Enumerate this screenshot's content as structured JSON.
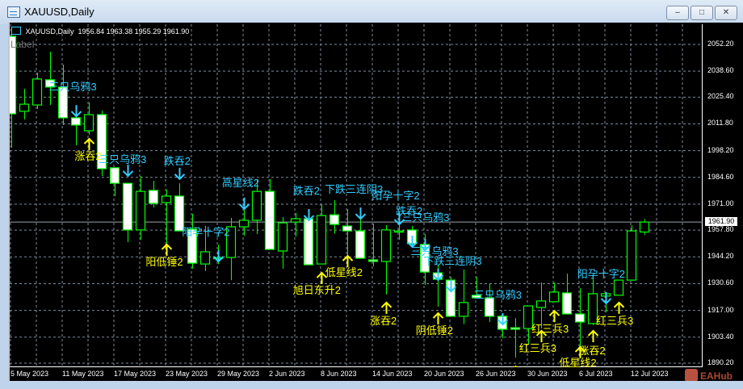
{
  "window": {
    "title": "XAUUSD,Daily",
    "buttons": [
      "minimize",
      "maximize",
      "close"
    ]
  },
  "chart_header": {
    "symbol": "XAUUSD,Daily",
    "open": "1956.84",
    "high": "1963.38",
    "low": "1955.29",
    "close": "1961.90",
    "label_object": "Label"
  },
  "colors": {
    "background": "#000000",
    "bull_outline": "#00ff00",
    "bear_fill": "#ffffff",
    "grid": "#7f8c9a",
    "bearish_signal": "#33ccff",
    "bullish_signal": "#ffff00"
  },
  "watermark": "EAHub",
  "chart_data": {
    "type": "candlestick",
    "title": "XAUUSD,Daily",
    "ylim": [
      1890.2,
      2052.2
    ],
    "price_ticks": [
      "2052.20",
      "2038.60",
      "2025.40",
      "2011.80",
      "1998.20",
      "1984.60",
      "1971.00",
      "1957.80",
      "1944.20",
      "1930.60",
      "1917.00",
      "1903.40",
      "1890.20"
    ],
    "current_price": "1961.90",
    "date_labels": [
      "5 May 2023",
      "11 May 2023",
      "17 May 2023",
      "23 May 2023",
      "29 May 2023",
      "2 Jun 2023",
      "8 Jun 2023",
      "14 Jun 2023",
      "20 Jun 2023",
      "26 Jun 2023",
      "30 Jun 2023",
      "6 Jul 2023",
      "12 Jul 2023"
    ],
    "grid": true,
    "ohlc": [
      [
        2056.3,
        2058.4,
        1999.7,
        2016.9
      ],
      [
        2018.2,
        2029.6,
        2014.1,
        2021.8
      ],
      [
        2021.4,
        2037.8,
        2019.4,
        2034.6
      ],
      [
        2034.2,
        2048.5,
        2021.4,
        2030.5
      ],
      [
        2030.5,
        2041.9,
        2011.2,
        2014.9
      ],
      [
        2014.9,
        2018.2,
        2000.9,
        2011.2
      ],
      [
        2008.3,
        2022.7,
        2006.3,
        2016.5
      ],
      [
        2016.5,
        2018.6,
        1985.3,
        1989.0
      ],
      [
        1989.5,
        1989.5,
        1975.1,
        1981.6
      ],
      [
        1981.6,
        1981.6,
        1951.7,
        1957.9
      ],
      [
        1957.9,
        1985.3,
        1952.9,
        1977.5
      ],
      [
        1978.0,
        1982.9,
        1969.3,
        1971.4
      ],
      [
        1971.8,
        1978.4,
        1950.5,
        1975.1
      ],
      [
        1975.1,
        1981.6,
        1957.4,
        1957.4
      ],
      [
        1958.3,
        1966.1,
        1938.2,
        1941.0
      ],
      [
        1940.6,
        1959.9,
        1937.0,
        1946.8
      ],
      [
        1943.9,
        1950.5,
        1940.6,
        1943.9
      ],
      [
        1943.9,
        1964.0,
        1932.4,
        1959.5
      ],
      [
        1959.5,
        1968.0,
        1955.0,
        1962.8
      ],
      [
        1962.8,
        1983.3,
        1955.8,
        1977.5
      ],
      [
        1977.5,
        1983.7,
        1948.0,
        1948.0
      ],
      [
        1947.2,
        1964.4,
        1938.2,
        1961.5
      ],
      [
        1961.9,
        1966.5,
        1954.6,
        1963.6
      ],
      [
        1963.6,
        1963.6,
        1940.2,
        1940.2
      ],
      [
        1940.6,
        1971.0,
        1940.6,
        1965.2
      ],
      [
        1965.6,
        1973.0,
        1956.0,
        1960.7
      ],
      [
        1959.9,
        1968.5,
        1942.3,
        1957.4
      ],
      [
        1957.4,
        1965.2,
        1943.5,
        1943.5
      ],
      [
        1942.7,
        1961.1,
        1939.4,
        1941.9
      ],
      [
        1941.9,
        1960.3,
        1925.1,
        1957.9
      ],
      [
        1957.4,
        1967.3,
        1952.9,
        1957.4
      ],
      [
        1957.9,
        1959.9,
        1950.9,
        1950.9
      ],
      [
        1950.5,
        1955.8,
        1930.0,
        1936.5
      ],
      [
        1936.1,
        1940.2,
        1918.9,
        1932.8
      ],
      [
        1932.4,
        1934.1,
        1914.0,
        1914.0
      ],
      [
        1914.0,
        1937.8,
        1910.0,
        1921.0
      ],
      [
        1924.7,
        1934.1,
        1923.4,
        1923.4
      ],
      [
        1923.4,
        1930.8,
        1911.1,
        1914.0
      ],
      [
        1914.0,
        1914.0,
        1902.9,
        1907.4
      ],
      [
        1908.2,
        1913.1,
        1893.0,
        1907.4
      ],
      [
        1907.8,
        1919.3,
        1899.6,
        1919.3
      ],
      [
        1918.5,
        1931.2,
        1907.8,
        1921.8
      ],
      [
        1921.4,
        1931.2,
        1921.4,
        1926.3
      ],
      [
        1925.9,
        1935.7,
        1915.2,
        1915.2
      ],
      [
        1915.2,
        1928.3,
        1895.0,
        1911.1
      ],
      [
        1910.3,
        1935.3,
        1909.5,
        1925.5
      ],
      [
        1924.3,
        1925.5,
        1916.0,
        1925.5
      ],
      [
        1924.7,
        1932.4,
        1924.7,
        1932.4
      ],
      [
        1932.4,
        1960.3,
        1932.4,
        1957.4
      ],
      [
        1956.84,
        1963.38,
        1955.29,
        1961.9
      ]
    ],
    "down_arrows": [
      [
        5,
        2021.4
      ],
      [
        9,
        1991.1
      ],
      [
        13,
        1989.5
      ],
      [
        16,
        1947.6
      ],
      [
        18,
        1974.3
      ],
      [
        23,
        1968.5
      ],
      [
        27,
        1969.3
      ],
      [
        30,
        1966.5
      ],
      [
        31,
        1955.0
      ],
      [
        32,
        1953.3
      ],
      [
        33,
        1938.2
      ],
      [
        34,
        1932.4
      ],
      [
        38,
        1915.6
      ],
      [
        46,
        1926.3
      ]
    ],
    "up_arrows": [
      [
        6,
        2004.2
      ],
      [
        12,
        1950.5
      ],
      [
        24,
        1936.1
      ],
      [
        26,
        1944.7
      ],
      [
        29,
        1921.0
      ],
      [
        33,
        1915.6
      ],
      [
        39,
        1888.5
      ],
      [
        41,
        1906.6
      ],
      [
        42,
        1916.8
      ],
      [
        44,
        1898.4
      ],
      [
        45,
        1906.6
      ],
      [
        47,
        1921.0
      ]
    ],
    "annotations": [
      {
        "text": "三只乌鸦3",
        "kind": "bearish",
        "bar": 2.9,
        "price": 2030.5
      },
      {
        "text": "三只乌鸦3",
        "kind": "bearish",
        "bar": 6.75,
        "price": 1993.5
      },
      {
        "text": "跌吞2",
        "kind": "bearish",
        "bar": 11.8,
        "price": 1992.7
      },
      {
        "text": "高星线2",
        "kind": "bearish",
        "bar": 16.3,
        "price": 1981.6
      },
      {
        "text": "阳孕十字2",
        "kind": "bearish",
        "bar": 13.2,
        "price": 1956.6
      },
      {
        "text": "跌吞2",
        "kind": "bearish",
        "bar": 21.8,
        "price": 1977.5
      },
      {
        "text": "下跌三连阴3",
        "kind": "bearish",
        "bar": 24.25,
        "price": 1978.4
      },
      {
        "text": "阳孕十字2",
        "kind": "bearish",
        "bar": 27.9,
        "price": 1975.1
      },
      {
        "text": "跌吞2",
        "kind": "bearish",
        "bar": 29.75,
        "price": 1967.3
      },
      {
        "text": "三只乌鸦3",
        "kind": "bearish",
        "bar": 30.2,
        "price": 1964.0
      },
      {
        "text": "三只乌鸦3",
        "kind": "bearish",
        "bar": 30.9,
        "price": 1946.8
      },
      {
        "text": "下跌三连阴3",
        "kind": "bearish",
        "bar": 31.9,
        "price": 1941.9
      },
      {
        "text": "三只乌鸦3",
        "kind": "bearish",
        "bar": 35.8,
        "price": 1924.7
      },
      {
        "text": "阳孕十字2",
        "kind": "bearish",
        "bar": 43.8,
        "price": 1935.3
      },
      {
        "text": "涨吞2",
        "kind": "bullish",
        "bar": 4.9,
        "price": 1995.2
      },
      {
        "text": "阳低锤2",
        "kind": "bullish",
        "bar": 10.4,
        "price": 1941.4
      },
      {
        "text": "低星线2",
        "kind": "bullish",
        "bar": 24.3,
        "price": 1936.1
      },
      {
        "text": "旭日东升2",
        "kind": "bullish",
        "bar": 21.8,
        "price": 1927.1
      },
      {
        "text": "涨吞2",
        "kind": "bullish",
        "bar": 27.75,
        "price": 1911.5
      },
      {
        "text": "阴低锤2",
        "kind": "bullish",
        "bar": 31.3,
        "price": 1906.6
      },
      {
        "text": "红三兵3",
        "kind": "bullish",
        "bar": 40.25,
        "price": 1907.4
      },
      {
        "text": "红三兵3",
        "kind": "bullish",
        "bar": 39.3,
        "price": 1897.5
      },
      {
        "text": "涨吞2",
        "kind": "bullish",
        "bar": 43.9,
        "price": 1896.3
      },
      {
        "text": "红三兵3",
        "kind": "bullish",
        "bar": 45.25,
        "price": 1911.5
      },
      {
        "text": "低星线2",
        "kind": "bullish",
        "bar": 42.4,
        "price": 1890.2
      }
    ]
  }
}
